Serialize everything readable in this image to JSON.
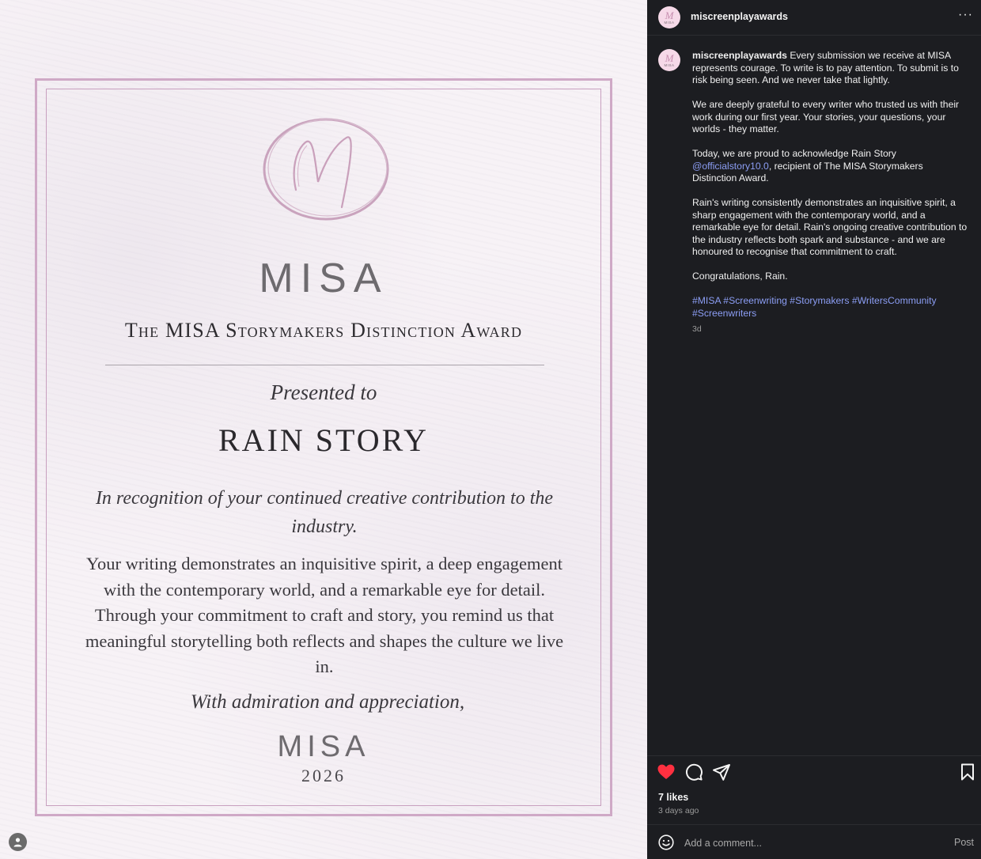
{
  "certificate": {
    "logo_text": "MISA",
    "award_title": "The MISA Storymakers Distinction Award",
    "presented_to": "Presented to",
    "recipient": "RAIN STORY",
    "recognition": "In recognition of your continued creative contribution to the industry.",
    "body": "Your writing demonstrates an inquisitive spirit, a deep engagement with the contemporary world, and a remarkable eye for detail. Through your commitment to craft and story, you remind us that meaningful storytelling both reflects and shapes the culture we live in.",
    "closing": "With admiration and appreciation,",
    "signature": "MISA",
    "year": "2026"
  },
  "post": {
    "username": "miscreenplayawards",
    "avatar_text": "MISA",
    "caption": {
      "intro": "Every submission we receive at MISA represents courage. To write is to pay attention. To submit is to risk being seen. And we never take that lightly.",
      "p2": "We are deeply grateful to every writer who trusted us with their work during our first year. Your stories, your questions, your worlds - they matter.",
      "p3_before": "Today, we are proud to acknowledge Rain Story ",
      "p3_mention": "@officialstory10.0",
      "p3_after": ", recipient of The MISA Storymakers Distinction Award.",
      "p4": "Rain's writing consistently demonstrates an inquisitive spirit, a sharp engagement with the contemporary world, and a remarkable eye for detail. Rain's ongoing creative contribution to the industry reflects both spark and substance - and we are honoured to recognise that commitment to craft.",
      "p5": "Congratulations, Rain.",
      "hashtags": "#MISA #Screenwriting #Storymakers #WritersCommunity #Screenwriters"
    },
    "caption_time": "3d",
    "likes": "7 likes",
    "time_ago": "3 days ago",
    "comment_placeholder": "Add a comment...",
    "post_label": "Post",
    "more_label": "···",
    "like_color": "#ff3040"
  }
}
